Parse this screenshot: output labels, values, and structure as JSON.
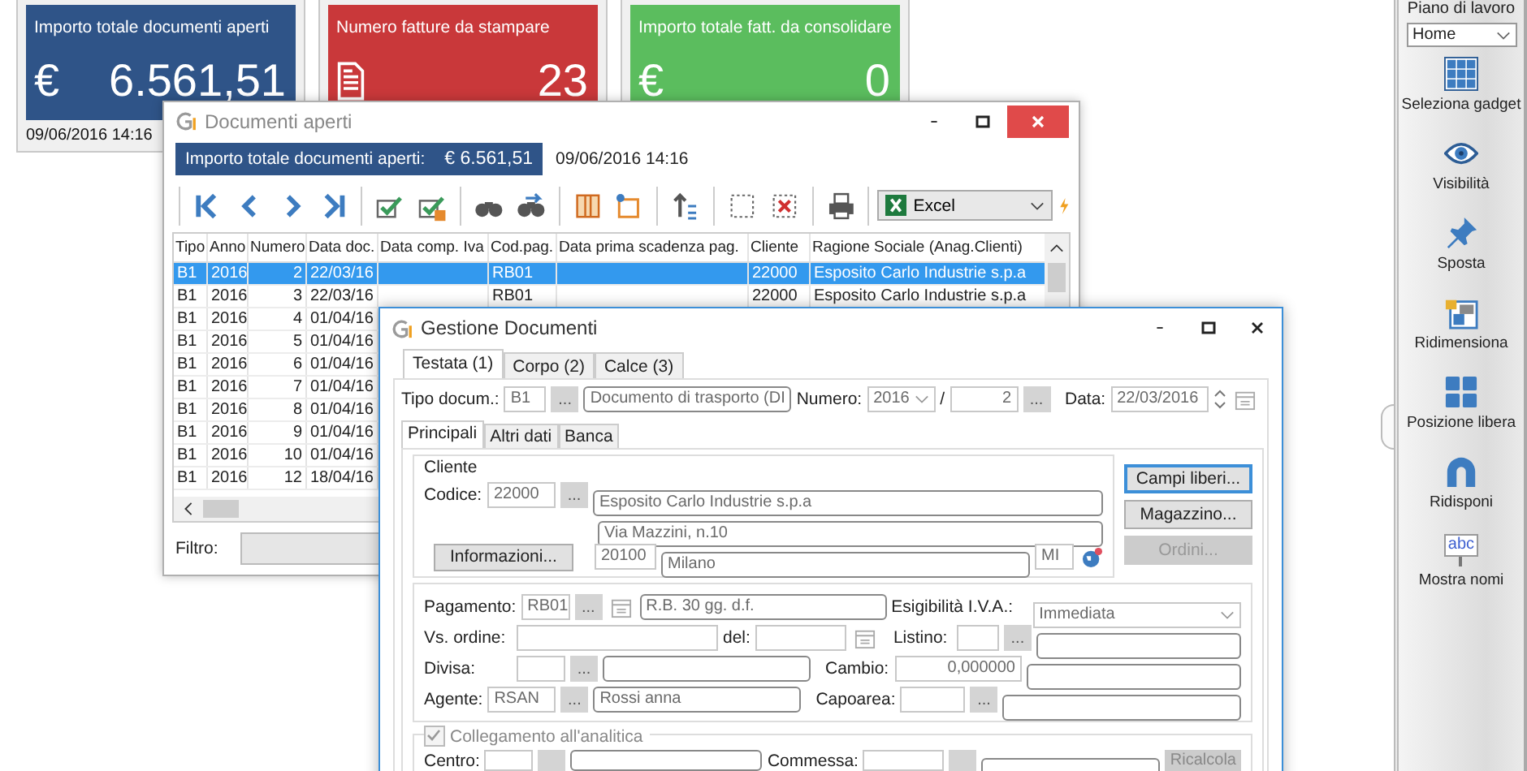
{
  "gadgets": [
    {
      "kind": "currency",
      "title": "Importo totale documenti aperti",
      "symbol": "€",
      "value": "6.561,51",
      "color": "#2f5488",
      "date": "09/06/2016 14:16"
    },
    {
      "kind": "document",
      "title": "Numero fatture da stampare",
      "value": "23",
      "color": "#c9383a"
    },
    {
      "kind": "currency",
      "title": "Importo totale fatt. da consolidare",
      "symbol": "€",
      "value": "0",
      "color": "#5bbd5e"
    }
  ],
  "documenti_aperti": {
    "title": "Documenti aperti",
    "summary_label": "Importo totale documenti aperti:",
    "summary_value": "€  6.561,51",
    "timestamp": "09/06/2016 14:16",
    "export_format": "Excel",
    "columns": [
      "Tipo",
      "Anno",
      "Numero",
      "Data doc.",
      "Data comp. Iva",
      "Cod.pag.",
      "Data prima scadenza pag.",
      "Cliente",
      "Ragione Sociale (Anag.Clienti)"
    ],
    "rows": [
      {
        "selected": true,
        "cells": [
          "B1",
          "2016",
          "2",
          "22/03/16",
          "",
          "RB01",
          "",
          "22000",
          "Esposito Carlo Industrie s.p.a"
        ]
      },
      {
        "selected": false,
        "cells": [
          "B1",
          "2016",
          "3",
          "22/03/16",
          "",
          "RB01",
          "",
          "22000",
          "Esposito Carlo Industrie s.p.a"
        ]
      },
      {
        "selected": false,
        "cells": [
          "B1",
          "2016",
          "4",
          "01/04/16"
        ]
      },
      {
        "selected": false,
        "cells": [
          "B1",
          "2016",
          "5",
          "01/04/16"
        ]
      },
      {
        "selected": false,
        "cells": [
          "B1",
          "2016",
          "6",
          "01/04/16"
        ]
      },
      {
        "selected": false,
        "cells": [
          "B1",
          "2016",
          "7",
          "01/04/16"
        ]
      },
      {
        "selected": false,
        "cells": [
          "B1",
          "2016",
          "8",
          "01/04/16"
        ]
      },
      {
        "selected": false,
        "cells": [
          "B1",
          "2016",
          "9",
          "01/04/16"
        ]
      },
      {
        "selected": false,
        "cells": [
          "B1",
          "2016",
          "10",
          "01/04/16"
        ]
      },
      {
        "selected": false,
        "cells": [
          "B1",
          "2016",
          "12",
          "18/04/16"
        ]
      }
    ],
    "filter_label": "Filtro:"
  },
  "gestione": {
    "title": "Gestione Documenti",
    "tabs": [
      {
        "label": "Testata (1)",
        "selected": true
      },
      {
        "label": "Corpo (2)",
        "selected": false
      },
      {
        "label": "Calce (3)",
        "selected": false
      }
    ],
    "tipo": {
      "label": "Tipo docum.:",
      "code": "B1",
      "browse": "...",
      "description": "Documento di trasporto (DI"
    },
    "numero": {
      "label": "Numero:",
      "year": "2016",
      "separator": "/",
      "value": "2",
      "browse": "..."
    },
    "data": {
      "label": "Data:",
      "value": "22/03/2016"
    },
    "subtabs": [
      {
        "label": "Principali",
        "selected": true
      },
      {
        "label": "Altri dati",
        "selected": false
      },
      {
        "label": "Banca",
        "selected": false
      }
    ],
    "cliente": {
      "legend": "Cliente",
      "code_label": "Codice:",
      "code": "22000",
      "browse": "...",
      "name": "Esposito Carlo Industrie s.p.a",
      "address": "Via Mazzini, n.10",
      "zip": "20100",
      "city": "Milano",
      "province": "MI",
      "info_button": "Informazioni..."
    },
    "side_buttons": [
      {
        "label": "Campi liberi...",
        "disabled": false
      },
      {
        "label": "Magazzino...",
        "disabled": false
      },
      {
        "label": "Ordini...",
        "disabled": true
      }
    ],
    "pagamento": {
      "label": "Pagamento:",
      "code": "RB01",
      "browse": "...",
      "description": "R.B. 30 gg. d.f."
    },
    "esigibilita": {
      "label": "Esigibilità I.V.A.:",
      "value": "Immediata"
    },
    "vs_ordine": {
      "label": "Vs. ordine:",
      "date_label": "del:"
    },
    "listino": {
      "label": "Listino:",
      "browse": "..."
    },
    "divisa": {
      "label": "Divisa:",
      "browse": "..."
    },
    "cambio": {
      "label": "Cambio:",
      "value": "0,000000"
    },
    "agente": {
      "label": "Agente:",
      "code": "RSAN",
      "browse": "...",
      "name": "Rossi anna"
    },
    "capoarea": {
      "label": "Capoarea:",
      "browse": "..."
    },
    "analitica": {
      "label": "Collegamento all'analitica",
      "checked": true,
      "disabled": true,
      "centro_label": "Centro:",
      "commessa_label": "Commessa:",
      "button": "Ricalcola"
    }
  },
  "sidebar": {
    "title": "Piano di lavoro",
    "workspace": "Home",
    "tools": [
      {
        "kind": "grid",
        "label": "Seleziona gadget"
      },
      {
        "kind": "eye",
        "label": "Visibilità"
      },
      {
        "kind": "pin",
        "label": "Sposta"
      },
      {
        "kind": "resize",
        "label": "Ridimensiona"
      },
      {
        "kind": "tiles",
        "label": "Posizione libera"
      },
      {
        "kind": "magnet",
        "label": "Ridisponi"
      },
      {
        "kind": "sign",
        "label": "Mostra nomi",
        "icon_text": "abc"
      }
    ]
  }
}
